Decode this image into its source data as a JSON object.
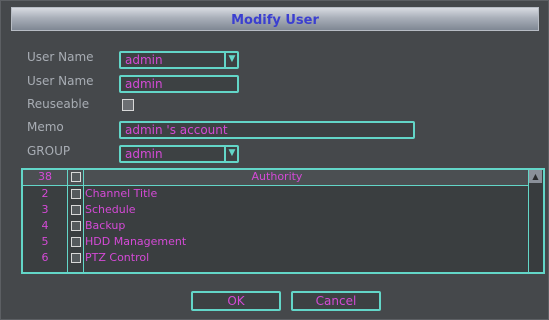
{
  "dialog": {
    "title": "Modify User"
  },
  "form": {
    "user_name_label": "User Name",
    "user_name_value": "admin",
    "user_name2_label": "User Name",
    "user_name2_value": "admin",
    "reusable_label": "Reuseable",
    "reusable_checked": false,
    "memo_label": "Memo",
    "memo_value": "admin 's account",
    "group_label": "GROUP",
    "group_value": "admin"
  },
  "authority": {
    "header_no": "38",
    "header_title": "Authority",
    "rows": [
      {
        "no": "2",
        "name": "Channel Title"
      },
      {
        "no": "3",
        "name": "Schedule"
      },
      {
        "no": "4",
        "name": "Backup"
      },
      {
        "no": "5",
        "name": "HDD Management"
      },
      {
        "no": "6",
        "name": "PTZ Control"
      }
    ]
  },
  "buttons": {
    "ok": "OK",
    "cancel": "Cancel"
  },
  "colors": {
    "accent": "#63d6c8",
    "value_text": "#d44ad6",
    "label_text": "#a8adb4",
    "title_text": "#3b3fd0"
  }
}
